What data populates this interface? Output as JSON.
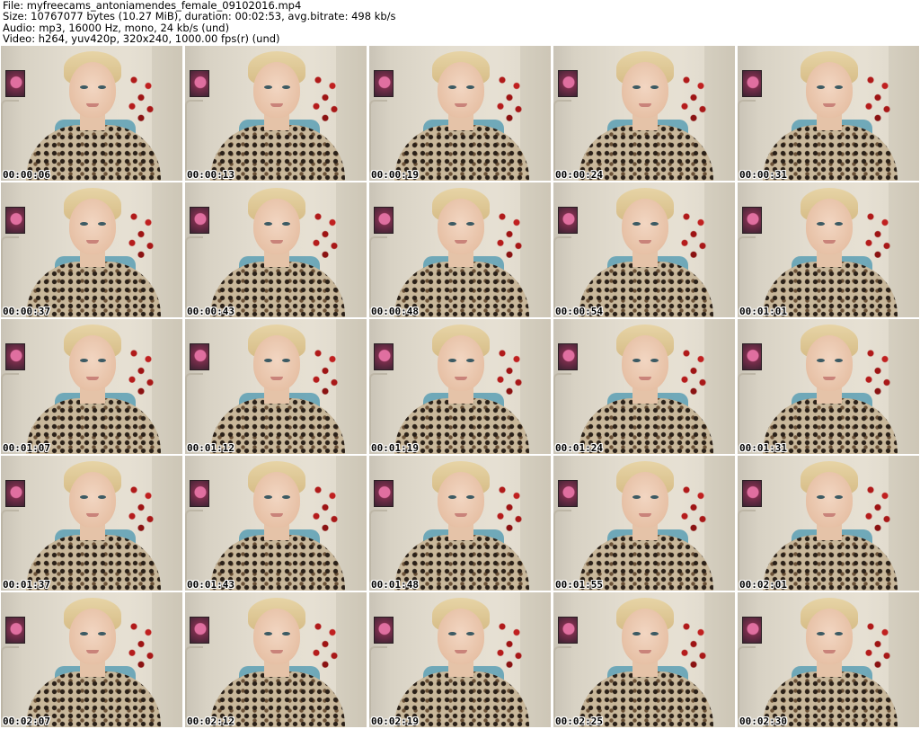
{
  "header": {
    "file_line": "File: myfreecams_antoniamendes_female_09102016.mp4",
    "size_line": "Size: 10767077 bytes (10.27 MiB), duration: 00:02:53, avg.bitrate: 498 kb/s",
    "audio_line": "Audio: mp3, 16000 Hz, mono, 24 kb/s (und)",
    "video_line": "Video: h264, yuv420p, 320x240, 1000.00 fps(r) (und)"
  },
  "thumbnails": [
    {
      "timestamp": "00:00:06"
    },
    {
      "timestamp": "00:00:13"
    },
    {
      "timestamp": "00:00:19"
    },
    {
      "timestamp": "00:00:24"
    },
    {
      "timestamp": "00:00:31"
    },
    {
      "timestamp": "00:00:37"
    },
    {
      "timestamp": "00:00:43"
    },
    {
      "timestamp": "00:00:48"
    },
    {
      "timestamp": "00:00:54"
    },
    {
      "timestamp": "00:01:01"
    },
    {
      "timestamp": "00:01:07"
    },
    {
      "timestamp": "00:01:12"
    },
    {
      "timestamp": "00:01:19"
    },
    {
      "timestamp": "00:01:24"
    },
    {
      "timestamp": "00:01:31"
    },
    {
      "timestamp": "00:01:37"
    },
    {
      "timestamp": "00:01:43"
    },
    {
      "timestamp": "00:01:48"
    },
    {
      "timestamp": "00:01:55"
    },
    {
      "timestamp": "00:02:01"
    },
    {
      "timestamp": "00:02:07"
    },
    {
      "timestamp": "00:02:12"
    },
    {
      "timestamp": "00:02:19"
    },
    {
      "timestamp": "00:02:25"
    },
    {
      "timestamp": "00:02:30"
    }
  ]
}
